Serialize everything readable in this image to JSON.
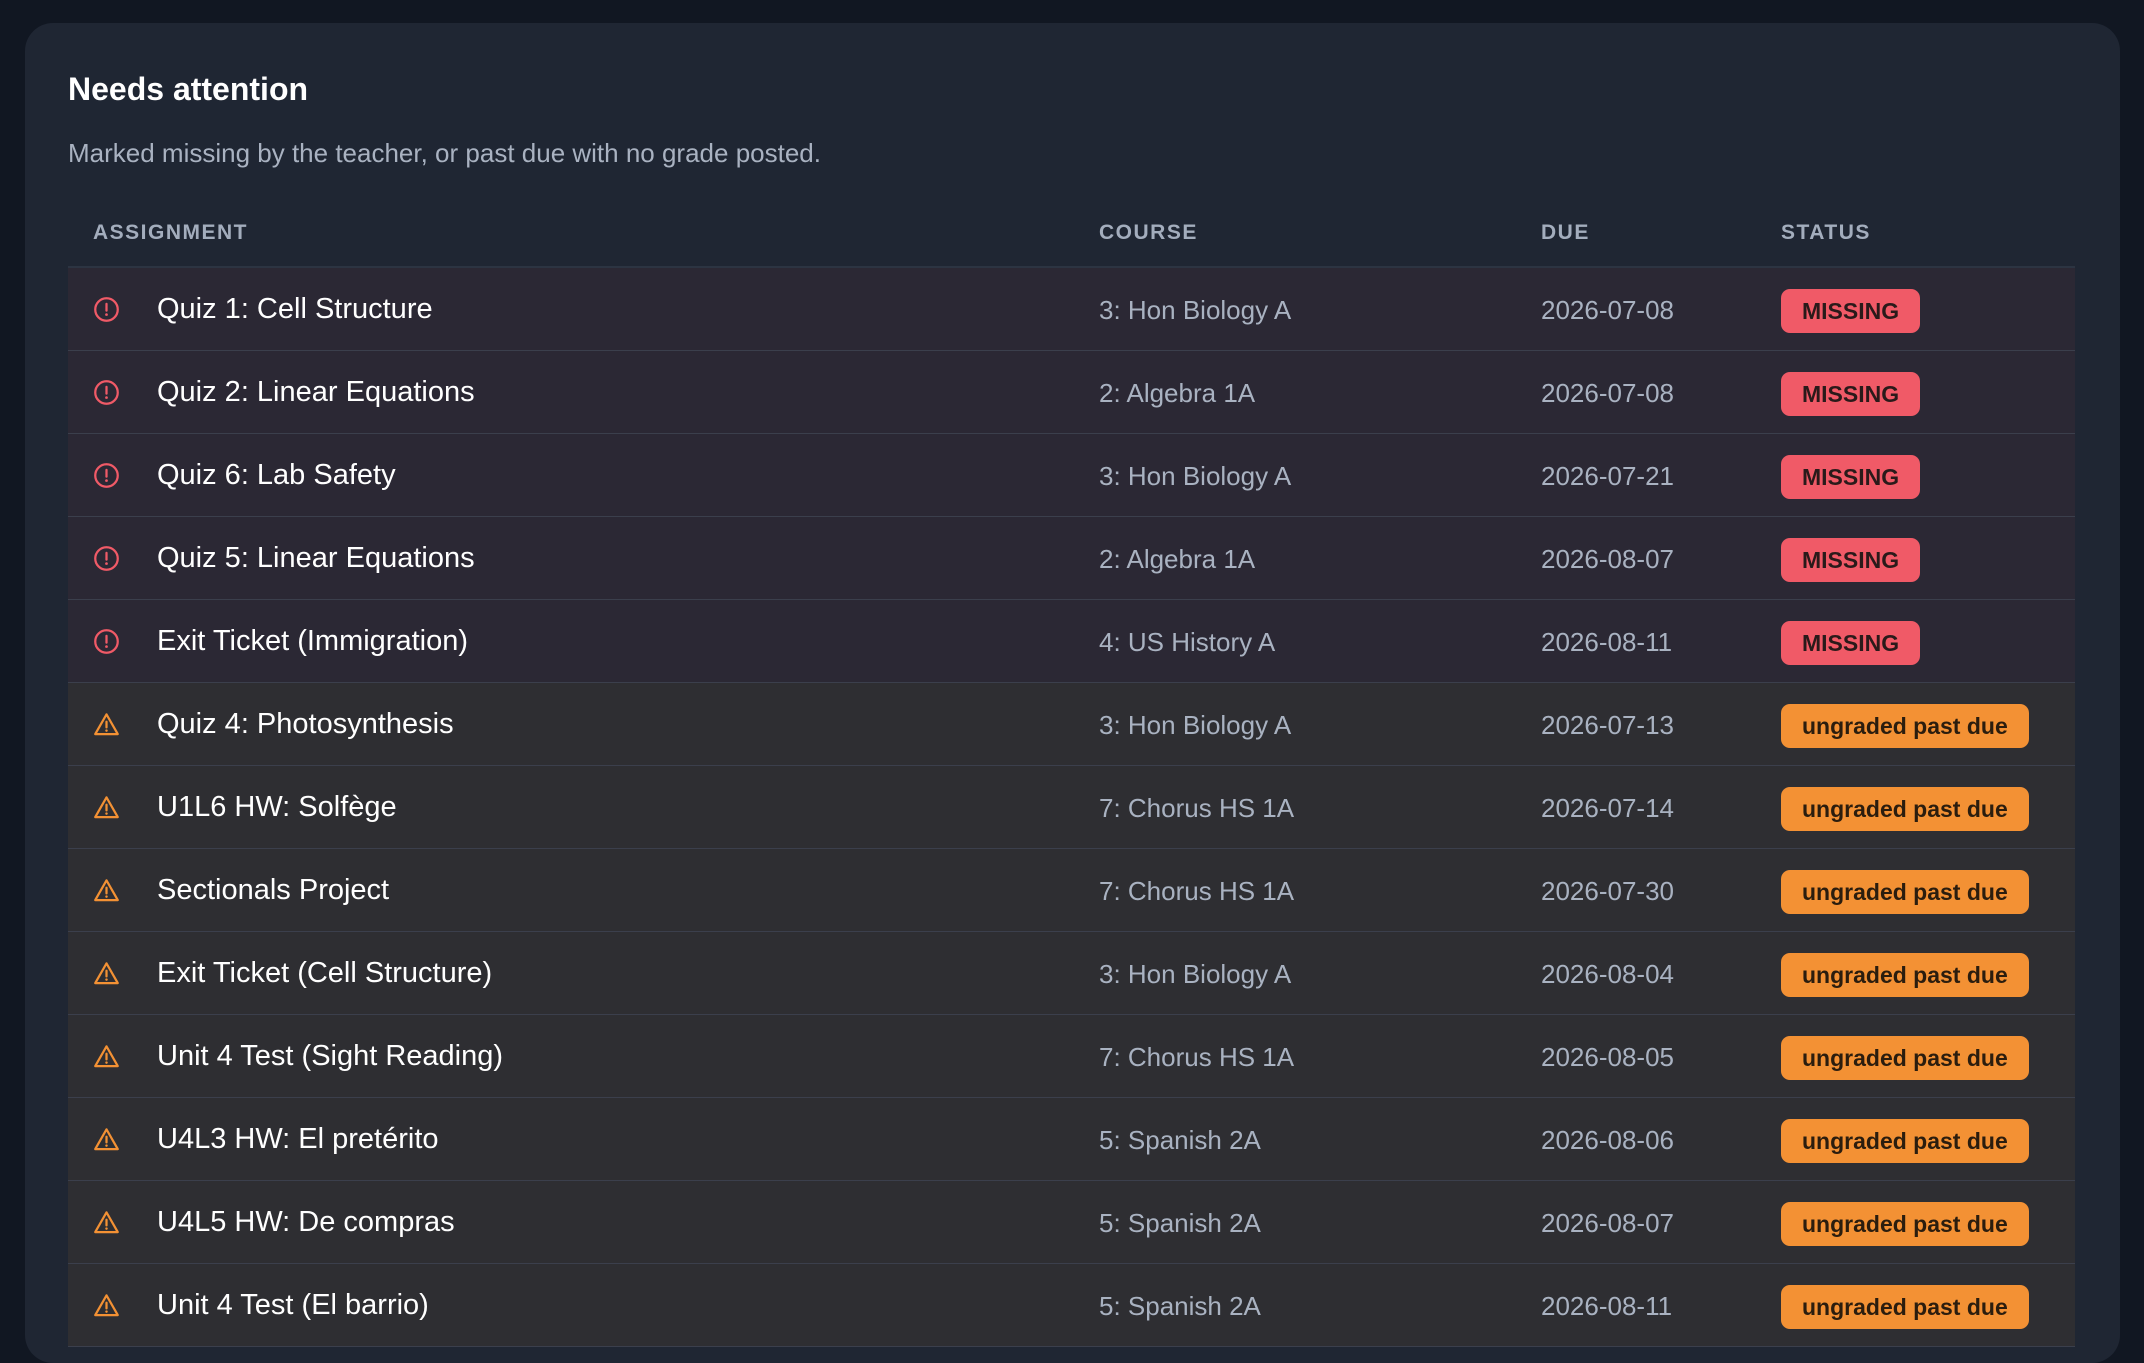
{
  "section": {
    "title": "Needs attention",
    "subtitle": "Marked missing by the teacher, or past due with no grade posted."
  },
  "colors": {
    "missing_badge": "#f05a67",
    "ungraded_badge": "#f39134",
    "missing_icon": "#f05a67",
    "ungraded_icon": "#f39134"
  },
  "table": {
    "headers": {
      "assignment": "ASSIGNMENT",
      "course": "COURSE",
      "due": "DUE",
      "status": "STATUS"
    },
    "rows": [
      {
        "kind": "missing",
        "icon": "alert-circle-icon",
        "name": "Quiz 1: Cell Structure",
        "course": "3: Hon Biology A",
        "due": "2026-07-08",
        "status": "MISSING"
      },
      {
        "kind": "missing",
        "icon": "alert-circle-icon",
        "name": "Quiz 2: Linear Equations",
        "course": "2: Algebra 1A",
        "due": "2026-07-08",
        "status": "MISSING"
      },
      {
        "kind": "missing",
        "icon": "alert-circle-icon",
        "name": "Quiz 6: Lab Safety",
        "course": "3: Hon Biology A",
        "due": "2026-07-21",
        "status": "MISSING"
      },
      {
        "kind": "missing",
        "icon": "alert-circle-icon",
        "name": "Quiz 5: Linear Equations",
        "course": "2: Algebra 1A",
        "due": "2026-08-07",
        "status": "MISSING"
      },
      {
        "kind": "missing",
        "icon": "alert-circle-icon",
        "name": "Exit Ticket (Immigration)",
        "course": "4: US History A",
        "due": "2026-08-11",
        "status": "MISSING"
      },
      {
        "kind": "ungraded",
        "icon": "warning-triangle-icon",
        "name": "Quiz 4: Photosynthesis",
        "course": "3: Hon Biology A",
        "due": "2026-07-13",
        "status": "ungraded past due"
      },
      {
        "kind": "ungraded",
        "icon": "warning-triangle-icon",
        "name": "U1L6 HW: Solfège",
        "course": "7: Chorus HS 1A",
        "due": "2026-07-14",
        "status": "ungraded past due"
      },
      {
        "kind": "ungraded",
        "icon": "warning-triangle-icon",
        "name": "Sectionals Project",
        "course": "7: Chorus HS 1A",
        "due": "2026-07-30",
        "status": "ungraded past due"
      },
      {
        "kind": "ungraded",
        "icon": "warning-triangle-icon",
        "name": "Exit Ticket (Cell Structure)",
        "course": "3: Hon Biology A",
        "due": "2026-08-04",
        "status": "ungraded past due"
      },
      {
        "kind": "ungraded",
        "icon": "warning-triangle-icon",
        "name": "Unit 4 Test (Sight Reading)",
        "course": "7: Chorus HS 1A",
        "due": "2026-08-05",
        "status": "ungraded past due"
      },
      {
        "kind": "ungraded",
        "icon": "warning-triangle-icon",
        "name": "U4L3 HW: El pretérito",
        "course": "5: Spanish 2A",
        "due": "2026-08-06",
        "status": "ungraded past due"
      },
      {
        "kind": "ungraded",
        "icon": "warning-triangle-icon",
        "name": "U4L5 HW: De compras",
        "course": "5: Spanish 2A",
        "due": "2026-08-07",
        "status": "ungraded past due"
      },
      {
        "kind": "ungraded",
        "icon": "warning-triangle-icon",
        "name": "Unit 4 Test (El barrio)",
        "course": "5: Spanish 2A",
        "due": "2026-08-11",
        "status": "ungraded past due"
      }
    ]
  }
}
